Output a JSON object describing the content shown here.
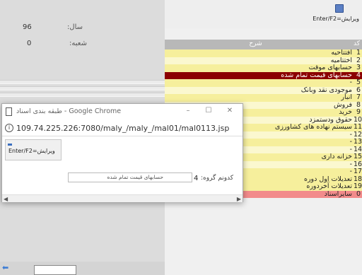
{
  "left_panel": {
    "year_label": "سال:",
    "year_value": "96",
    "branch_label": "شعبه:",
    "branch_value": "0"
  },
  "right_panel": {
    "edit_button_label": "Enter/F2=ویرایش",
    "header": {
      "description": "شرح",
      "code": "کد"
    },
    "rows": [
      {
        "code": "1",
        "desc": "افتتاحیه"
      },
      {
        "code": "2",
        "desc": "اختتامیه"
      },
      {
        "code": "3",
        "desc": "حسابهای موقت"
      },
      {
        "code": "4",
        "desc": "حسابهای قیمت تمام شده"
      },
      {
        "code": "5",
        "desc": "-"
      },
      {
        "code": "6",
        "desc": "موجودی نقد وبانک"
      },
      {
        "code": "7",
        "desc": "انبار"
      },
      {
        "code": "8",
        "desc": "فروش"
      },
      {
        "code": "9",
        "desc": "خرید"
      },
      {
        "code": "10",
        "desc": "حقوق ودستمزد"
      },
      {
        "code": "11",
        "desc": "سیستم نهاده های کشاورزی"
      },
      {
        "code": "12",
        "desc": "-"
      },
      {
        "code": "13",
        "desc": "-"
      },
      {
        "code": "14",
        "desc": "-"
      },
      {
        "code": "15",
        "desc": "خزانه داری"
      },
      {
        "code": "16",
        "desc": "-"
      },
      {
        "code": "17",
        "desc": "-"
      },
      {
        "code": "18",
        "desc": "تعدیلات اول دوره"
      },
      {
        "code": "19",
        "desc": "تعدیلات آخردوره"
      },
      {
        "code": "0",
        "desc": "سایراسناد"
      }
    ],
    "row_colors": {
      "yellow": "#f6ef9c",
      "selected": "#8b0000",
      "last": "#f28b8b"
    }
  },
  "popup": {
    "title": "طبقه بندی اسناد - Google Chrome",
    "url": "109.74.225.226:7080/maly_/maly_/mal01/mal0113.jsp",
    "controls": {
      "minimize": "–",
      "maximize": "☐",
      "close": "✕"
    },
    "edit_button_label": "Enter/F2=ویرایش",
    "group_label": "کدونم گروه:",
    "group_number": "4",
    "group_name": "حسابهای قیمت تمام شده"
  }
}
